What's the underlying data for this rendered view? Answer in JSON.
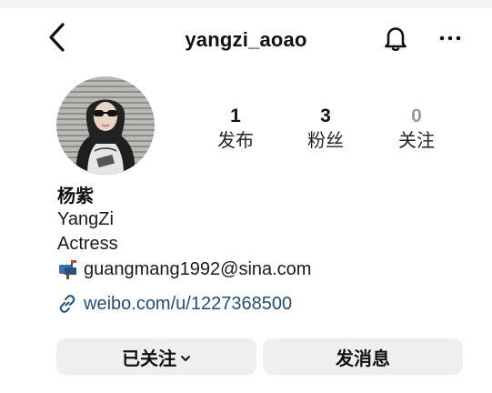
{
  "header": {
    "username": "yangzi_aoao",
    "back_icon": "chevron-left-icon",
    "bell_icon": "bell-icon",
    "more_icon": "more-horizontal-icon"
  },
  "profile": {
    "avatar_icon": "profile-photo",
    "stats": [
      {
        "value": "1",
        "label": "发布"
      },
      {
        "value": "3",
        "label": "粉丝"
      },
      {
        "value": "0",
        "label": "关注"
      }
    ],
    "display_name": "杨紫",
    "name_en": "YangZi",
    "occupation": "Actress",
    "email": "guangmang1992@sina.com",
    "email_icon": "mailbox-icon",
    "link": "weibo.com/u/1227368500",
    "link_icon": "link-icon"
  },
  "actions": {
    "follow_label": "已关注",
    "message_label": "发消息"
  },
  "colors": {
    "link": "#1f4e78",
    "button_bg": "#efefef",
    "muted": "#9a9a9a"
  }
}
